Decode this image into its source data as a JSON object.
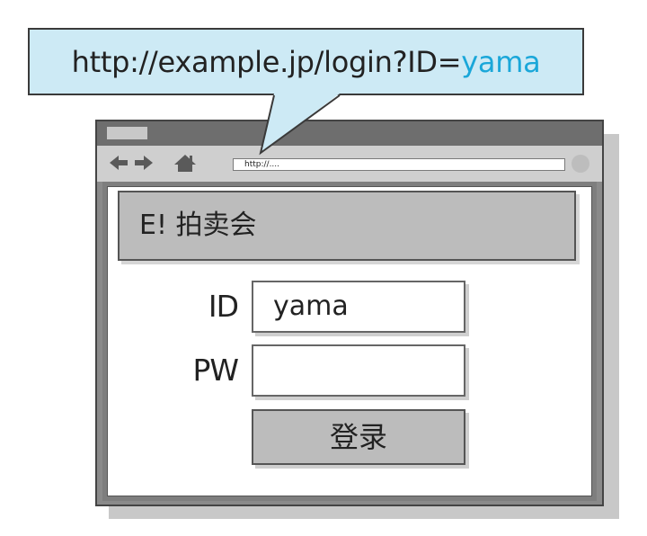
{
  "callout": {
    "url_prefix": "http://example.jp/login?ID=",
    "url_param_value": "yama",
    "highlight_color": "#1aa7d9",
    "background_color": "#cdeaf5"
  },
  "browser": {
    "address_bar_text": "http://....",
    "nav_icons": [
      "back-arrow-icon",
      "forward-arrow-icon",
      "home-icon"
    ]
  },
  "page": {
    "title": "E! 拍卖会"
  },
  "form": {
    "id_label": "ID",
    "id_value": "yama",
    "pw_label": "PW",
    "pw_value": "",
    "login_button_label": "登录"
  }
}
